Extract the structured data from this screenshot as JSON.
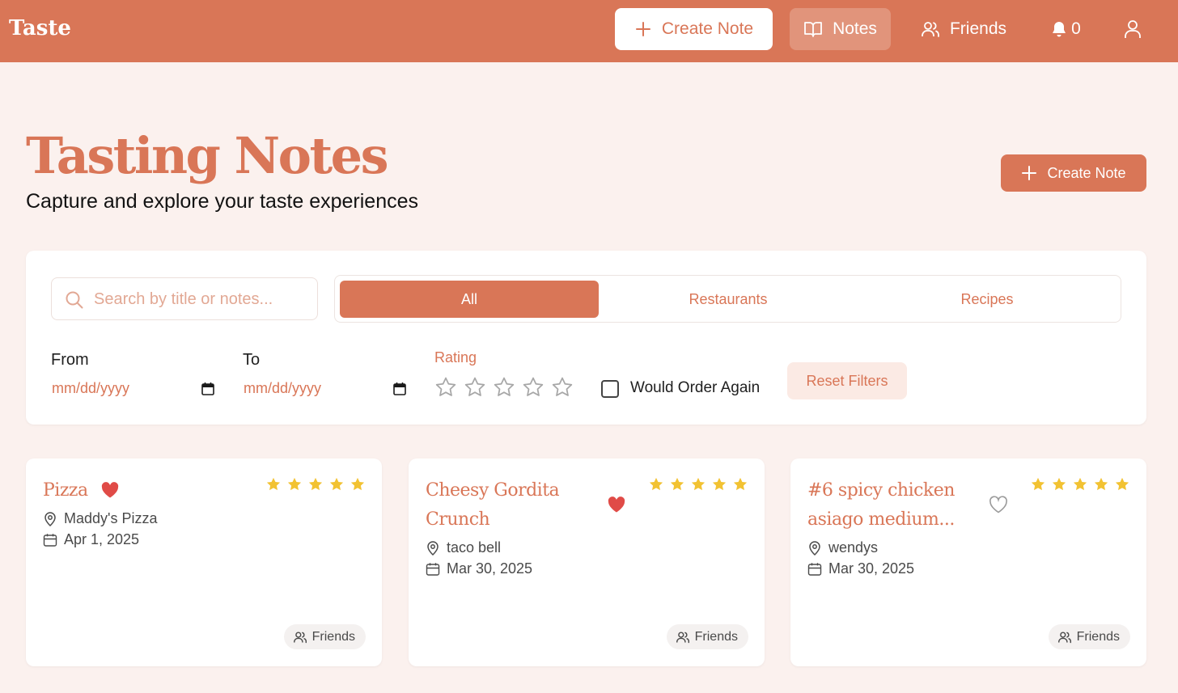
{
  "header": {
    "brand": "Taste",
    "create_label": "Create Note",
    "notes_label": "Notes",
    "friends_label": "Friends",
    "notification_count": "0"
  },
  "hero": {
    "title": "Tasting Notes",
    "subtitle": "Capture and explore your taste experiences",
    "create_label": "Create Note"
  },
  "filters": {
    "search_placeholder": "Search by title or notes...",
    "tabs": [
      {
        "label": "All",
        "active": true
      },
      {
        "label": "Restaurants",
        "active": false
      },
      {
        "label": "Recipes",
        "active": false
      }
    ],
    "from_label": "From",
    "to_label": "To",
    "date_placeholder": "mm/dd/yyyy",
    "rating_label": "Rating",
    "rating_selected": 0,
    "rating_max": 5,
    "would_order_label": "Would Order Again",
    "would_order_checked": false,
    "reset_label": "Reset Filters"
  },
  "cards": [
    {
      "title_lines": [
        "Pizza"
      ],
      "location": "Maddy's Pizza",
      "date": "Apr 1, 2025",
      "rating": 5,
      "favorite": true,
      "visibility": "Friends"
    },
    {
      "title_lines": [
        "Cheesy Gordita",
        "Crunch"
      ],
      "location": "taco bell",
      "date": "Mar 30, 2025",
      "rating": 5,
      "favorite": true,
      "visibility": "Friends"
    },
    {
      "title_lines": [
        "#6 spicy chicken",
        "asiago medium..."
      ],
      "location": "wendys",
      "date": "Mar 30, 2025",
      "rating": 5,
      "favorite": false,
      "visibility": "Friends"
    }
  ],
  "colors": {
    "accent": "#d97657",
    "background": "#fbf1ee",
    "star": "#f2c232",
    "heart": "#e04b47",
    "heart_outline": "#9a9a9a"
  }
}
